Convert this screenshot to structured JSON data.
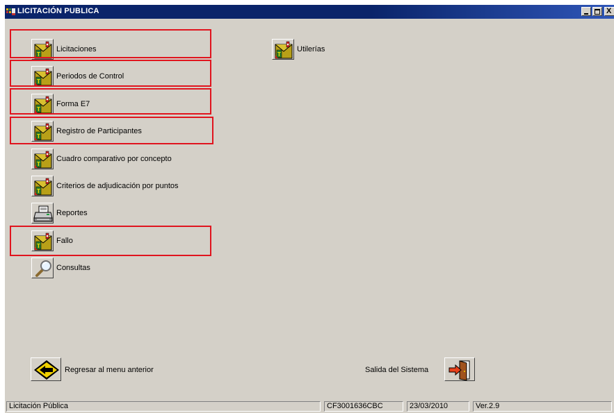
{
  "window": {
    "title": "LICITACIÓN PUBLICA",
    "controls": [
      "minimize-icon",
      "maximize-icon",
      "close-icon"
    ]
  },
  "menu": {
    "left": [
      {
        "label": "Licitaciones",
        "icon": "envelope-folder-icon",
        "highlighted": true
      },
      {
        "label": "Periodos de Control",
        "icon": "envelope-folder-icon",
        "highlighted": true
      },
      {
        "label": "Forma E7",
        "icon": "envelope-folder-icon",
        "highlighted": true
      },
      {
        "label": "Registro de Participantes",
        "icon": "envelope-folder-icon",
        "highlighted": true
      },
      {
        "label": "Cuadro comparativo por concepto",
        "icon": "envelope-folder-icon",
        "highlighted": false
      },
      {
        "label": "Criterios de adjudicación por puntos",
        "icon": "envelope-folder-icon",
        "highlighted": false
      },
      {
        "label": "Reportes",
        "icon": "printer-icon",
        "highlighted": false
      },
      {
        "label": "Fallo",
        "icon": "envelope-folder-icon",
        "highlighted": true
      },
      {
        "label": "Consultas",
        "icon": "magnifier-icon",
        "highlighted": false
      }
    ],
    "right": [
      {
        "label": "Utilerías",
        "icon": "envelope-folder-icon"
      }
    ]
  },
  "bottom": {
    "back_label": "Regresar al menu anterior",
    "exit_label": "Salida del Sistema"
  },
  "status": {
    "module": "Licitación Pública",
    "machine": "CF3001636CBC",
    "date": "23/03/2010",
    "version": "Ver.2.9"
  },
  "colors": {
    "title_bar": "#0a246a",
    "window_face": "#d4d0c8",
    "highlight_box": "#e0141e"
  }
}
